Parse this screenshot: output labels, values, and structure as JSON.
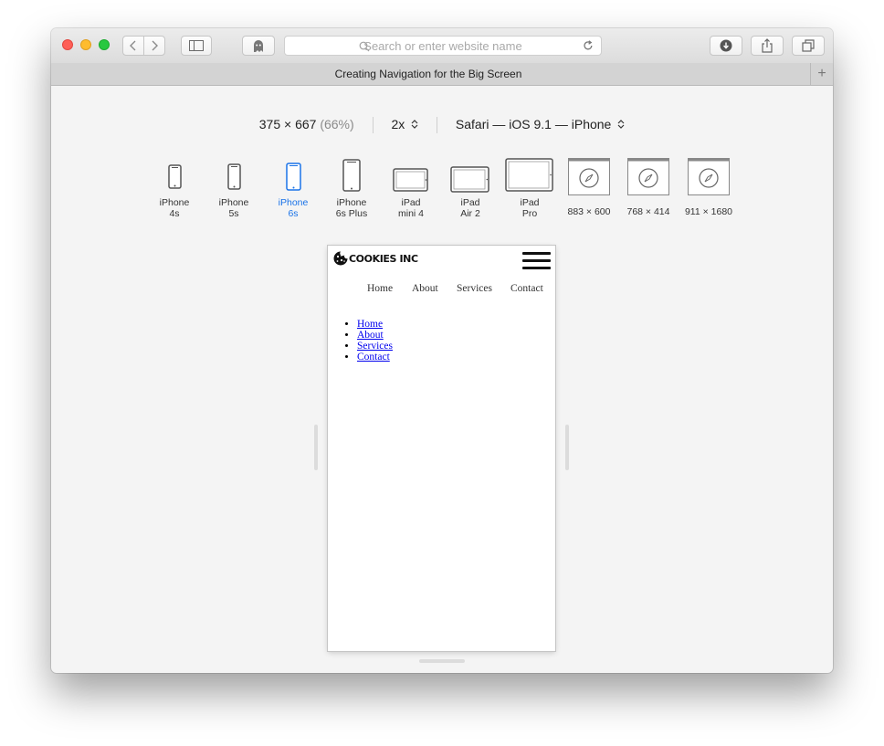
{
  "toolbar": {
    "address_placeholder": "Search or enter website name"
  },
  "tab": {
    "title": "Creating Navigation for the Big Screen",
    "new_tab_glyph": "+"
  },
  "responsive_bar": {
    "size": "375 × 667",
    "zoom": "(66%)",
    "scale": "2x",
    "scale_chevron": "⌃⌄",
    "user_agent": "Safari — iOS 9.1 — iPhone",
    "ua_chevron": "⌃⌄"
  },
  "devices": [
    {
      "line1": "iPhone",
      "line2": "4s",
      "icon": "phone-icon"
    },
    {
      "line1": "iPhone",
      "line2": "5s",
      "icon": "phone-icon"
    },
    {
      "line1": "iPhone",
      "line2": "6s",
      "icon": "phone-icon",
      "selected": true
    },
    {
      "line1": "iPhone",
      "line2": "6s Plus",
      "icon": "phone-icon"
    },
    {
      "line1": "iPad",
      "line2": "mini 4",
      "icon": "tablet-icon"
    },
    {
      "line1": "iPad",
      "line2": "Air 2",
      "icon": "tablet-icon"
    },
    {
      "line1": "iPad",
      "line2": "Pro",
      "icon": "tablet-icon"
    },
    {
      "line1": "883 × 600",
      "line2": "",
      "icon": "compass-icon"
    },
    {
      "line1": "768 × 414",
      "line2": "",
      "icon": "compass-icon"
    },
    {
      "line1": "911 × 1680",
      "line2": "",
      "icon": "compass-icon"
    }
  ],
  "site": {
    "logo": "COOKIES INC",
    "nav": [
      "Home",
      "About",
      "Services",
      "Contact"
    ],
    "links": [
      "Home",
      "About",
      "Services",
      "Contact"
    ]
  },
  "colors": {
    "accent": "#1a73e8",
    "link": "#0000ee",
    "close": "#fe5f57",
    "minimize": "#febc2e",
    "zoom": "#28c840"
  }
}
